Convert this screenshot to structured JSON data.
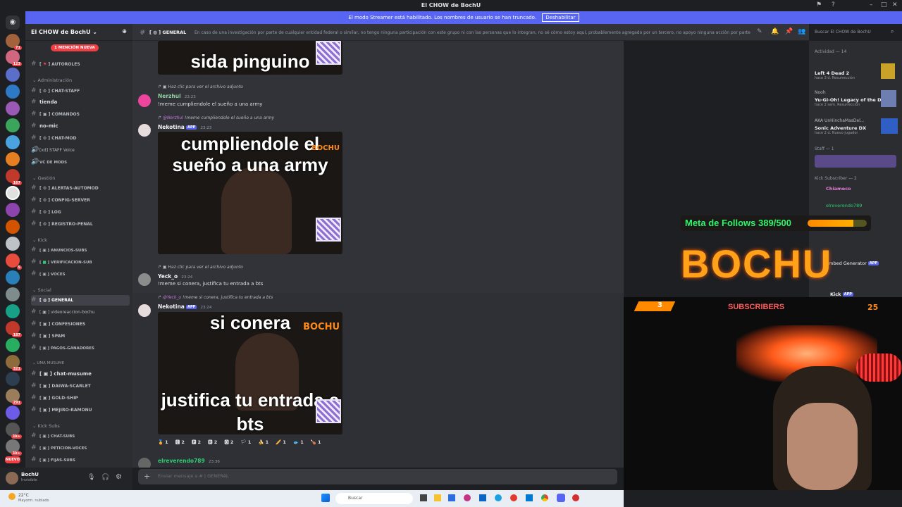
{
  "window": {
    "title": "El CHOW de BochU"
  },
  "banner": {
    "text": "El modo Streamer está habilitado. Los nombres de usuario se han truncado.",
    "button": "Deshabilitar"
  },
  "server": {
    "name": "El CHOW de BochU",
    "mention_badge": "1 MENCIÓN NUEVA"
  },
  "servers_badges": [
    "71",
    "123",
    "167",
    "5",
    "187",
    "1",
    "321",
    "291",
    "1k+",
    "1k+",
    "NUEVO"
  ],
  "categories": {
    "admin": "Administración",
    "gestion": "Gestión",
    "kick": "Kick",
    "social": "Social",
    "uma": "UMA MUSUME",
    "kicksubs": "Kick Subs"
  },
  "channels": {
    "autoroles": "AUTOROLES",
    "chat_staff": "CHAT-STAFF",
    "tienda": "tienda",
    "comandos": "COMANDOS",
    "no_mic": "no-mic",
    "chat_mod": "CHAT-MOD",
    "staff_voice": "[xd] STAFF Voice",
    "vc_mods": "VC DE MODS",
    "alertas": "ALERTAS-AUTOMOD",
    "config": "CONFIG-SERVER",
    "log": "LOG",
    "registro": "REGISTRO-PENAL",
    "anuncios_subs": "ANUNCIOS-SUBS",
    "verificacion": "VERIFICACION-SUB",
    "voces": "VOCES",
    "general": "GENERAL",
    "videoreaccion": "videoreaccion-bochu",
    "confesiones": "CONFESIONES",
    "spam": "SPAM",
    "pagos": "PAGOS-GANADORES",
    "chat_musume": "chat-musume",
    "daiwa": "DAIWA-SCARLET",
    "gold": "GOLD-SHIP",
    "mejiro": "MEJIRO-RAMONU",
    "chat_subs": "CHAT-SUBS",
    "peticion": "PETICION-VOCES",
    "fijas": "FIJAS-SUBS"
  },
  "user": {
    "name": "BochU",
    "status": "Invisible"
  },
  "channel_header": {
    "name": "GENERAL",
    "topic": "En caso de una investigación por parte de cualquier entidad federal o similar, no tengo ninguna participación con este grupo ni con las personas que lo integran, no sé cómo estoy aquí, probablemente agregado por un tercero, no apoyo ninguna acción por parte de...",
    "search_placeholder": "Buscar El CHOW de BochU"
  },
  "messages": {
    "meme1_caption": "sida pinguino",
    "m1_reply": "Haz clic para ver el archivo adjunto",
    "m1_user": "Nerzhul",
    "m1_time": "23:23",
    "m1_text": "!meme cumpliendole el sueño a una army",
    "m2_reply_user": "@Nerzhul",
    "m2_reply": "!meme cumpliendole el sueño a una army",
    "m2_user": "Nekotina",
    "m2_app": "APP",
    "m2_time": "23:23",
    "meme2_caption": "cumpliendole el sueño a una army",
    "m3_reply": "Haz clic para ver el archivo adjunto",
    "m3_user": "Yeck_o",
    "m3_time": "23:24",
    "m3_text": "!meme si conera, justifica tu entrada a bts",
    "m4_reply_user": "@Yeck_o",
    "m4_reply": "!meme si conera, justifica tu entrada a bts",
    "m4_user": "Nekotina",
    "m4_app": "APP",
    "m4_time": "23:24",
    "meme3_top": "si conera",
    "meme3_bottom": "justifica tu entrada a bts",
    "m5_user": "elreverendo789",
    "m5_time": "23:36",
    "watermark": "BOCHU"
  },
  "reactions": [
    "1",
    "2",
    "2",
    "2",
    "2",
    "1",
    "1",
    "1",
    "1",
    "1"
  ],
  "composer": {
    "placeholder": "Enviar mensaje a # | GENERAL"
  },
  "members": {
    "activity_header": "Actividad — 14",
    "a1_game": "Left 4 Dead 2",
    "a1_sub": "hace 3 d. Resurrección",
    "a2_user": "Nooh",
    "a2_game": "Yu-Gi-Oh! Legacy of the D...",
    "a2_sub": "hace 2 sem. Resurrección",
    "a3_user": "AKA UnHinchaMasDel...",
    "a3_game": "Sonic Adventure DX",
    "a3_sub": "hace 2 d. Nuevo jugador",
    "staff_header": "Staff — 1",
    "kick_header": "Kick Subscriber — 2",
    "k1": "Chiameco",
    "k2": "elreverendo789",
    "bot1": "Embed Generator",
    "bot2": "Kick",
    "app": "APP"
  },
  "overlay": {
    "follows": "Meta de Follows 389/500",
    "follows_progress": 0.778,
    "logo": "BOCHU",
    "subscribers": "SUBSCRIBERS",
    "sub_count": "25",
    "sub_left": "3"
  },
  "taskbar": {
    "search": "Buscar",
    "weather": "22°C",
    "weather_sub": "Mayorm. nublado"
  },
  "colors": {
    "blurple": "#5865f2",
    "green": "#2ff36a",
    "orange": "#ffa21a"
  }
}
